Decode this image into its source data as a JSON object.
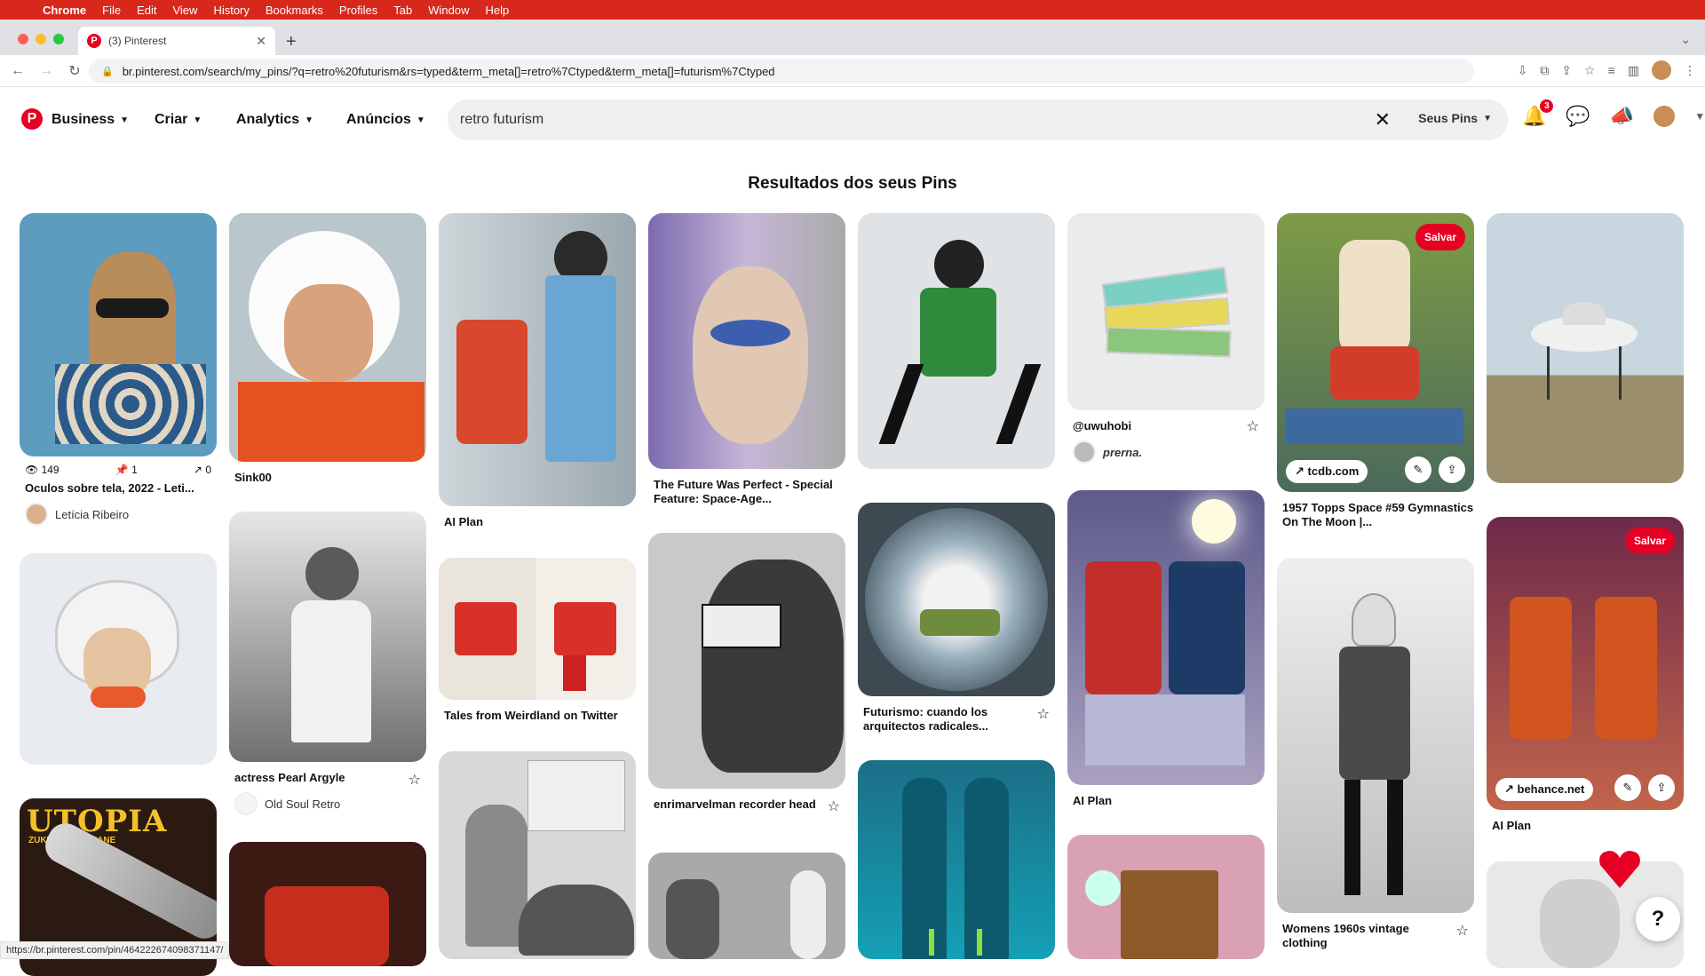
{
  "menubar": {
    "items": [
      "Chrome",
      "File",
      "Edit",
      "View",
      "History",
      "Bookmarks",
      "Profiles",
      "Tab",
      "Window",
      "Help"
    ]
  },
  "browser": {
    "tab_title": "(3) Pinterest",
    "url": "br.pinterest.com/search/my_pins/?q=retro%20futurism&rs=typed&term_meta[]=retro%7Ctyped&term_meta[]=futurism%7Ctyped",
    "status_url": "https://br.pinterest.com/pin/464222674098371147/"
  },
  "header": {
    "nav": [
      "Business",
      "Criar",
      "Analytics",
      "Anúncios"
    ],
    "search_value": "retro futurism",
    "search_scope": "Seus Pins",
    "notification_count": "3"
  },
  "results_title": "Resultados dos seus Pins",
  "pins": {
    "p1": {
      "views": "149",
      "saves": "1",
      "clicks": "0",
      "title": "Oculos sobre tela, 2022 - Leti...",
      "user": "Letícia Ribeiro"
    },
    "p2": {
      "title": "Sink00"
    },
    "p3": {
      "title": "actress Pearl Argyle",
      "user": "Old Soul Retro"
    },
    "p4": {
      "title": "AI Plan"
    },
    "p5": {
      "title": "Tales from Weirdland on Twitter"
    },
    "p6": {
      "title": "The Future Was Perfect - Special Feature: Space-Age..."
    },
    "p7": {
      "title": "enrimarvelman recorder head"
    },
    "p8": {
      "title": "Futurismo: cuando los arquitectos radicales..."
    },
    "p9": {
      "handle": "@uwuhobi",
      "user": "prerna."
    },
    "p10": {
      "title": "AI Plan"
    },
    "p11": {
      "title": "1957 Topps Space #59 Gymnastics On The Moon |...",
      "link": "tcdb.com",
      "save": "Salvar"
    },
    "p12": {
      "title": "Womens 1960s vintage clothing"
    },
    "p13": {
      "title": "AI Plan",
      "link": "behance.net",
      "save": "Salvar"
    },
    "utopia": {
      "big": "UTOPIA",
      "sub": "ZUKUNFTSROMANE"
    }
  }
}
